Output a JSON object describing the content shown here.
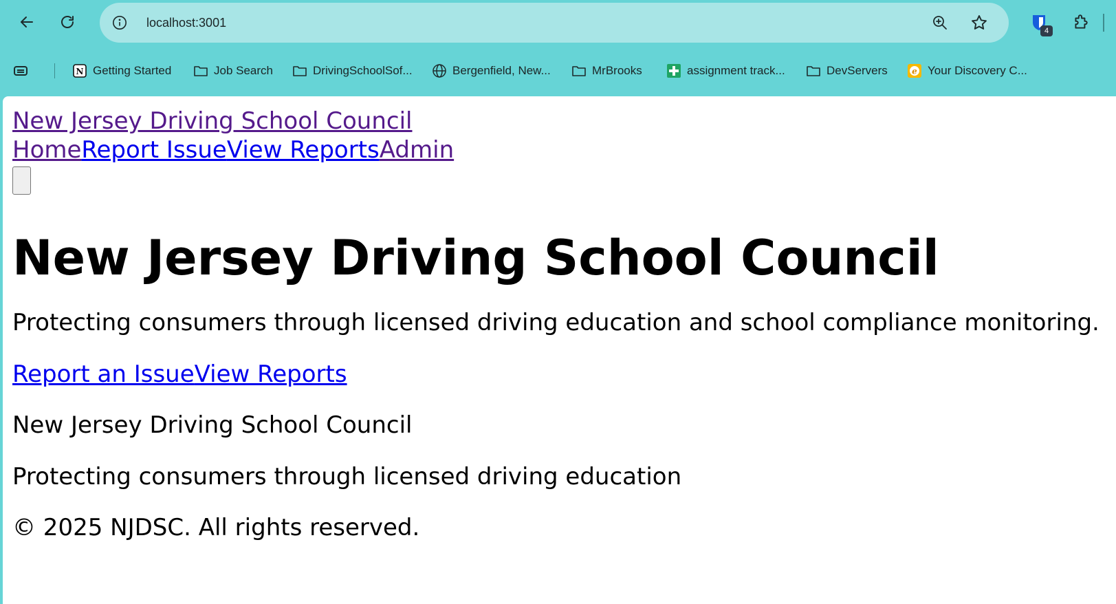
{
  "browser": {
    "url": "localhost:3001",
    "extension_badge": "4",
    "bookmarks": [
      {
        "label": "Getting Started",
        "icon": "notion-icon"
      },
      {
        "label": "Job Search",
        "icon": "folder-icon"
      },
      {
        "label": "DrivingSchoolSof...",
        "icon": "folder-icon"
      },
      {
        "label": "Bergenfield, New...",
        "icon": "globe-icon"
      },
      {
        "label": "MrBrooks",
        "icon": "folder-icon"
      },
      {
        "label": "assignment track...",
        "icon": "google-sheets-icon"
      },
      {
        "label": "DevServers",
        "icon": "folder-icon"
      },
      {
        "label": "Your Discovery C...",
        "icon": "discovery-icon"
      }
    ]
  },
  "site": {
    "title": "New Jersey Driving School Council",
    "nav": {
      "home": "Home",
      "report_issue": "Report Issue",
      "view_reports": "View Reports",
      "admin": "Admin"
    }
  },
  "hero": {
    "title": "New Jersey Driving School Council",
    "subtitle": "Protecting consumers through licensed driving education and school compliance monitoring.",
    "cta_report": "Report an Issue",
    "cta_view": "View Reports"
  },
  "footer": {
    "name": "New Jersey Driving School Council",
    "tagline": "Protecting consumers through licensed driving education",
    "copyright": "© 2025 NJDSC. All rights reserved."
  },
  "colors": {
    "chrome": "#66d4d6",
    "omnibox": "#a8e5e6",
    "link": "#0000ee",
    "visited_link": "#551a8b"
  }
}
